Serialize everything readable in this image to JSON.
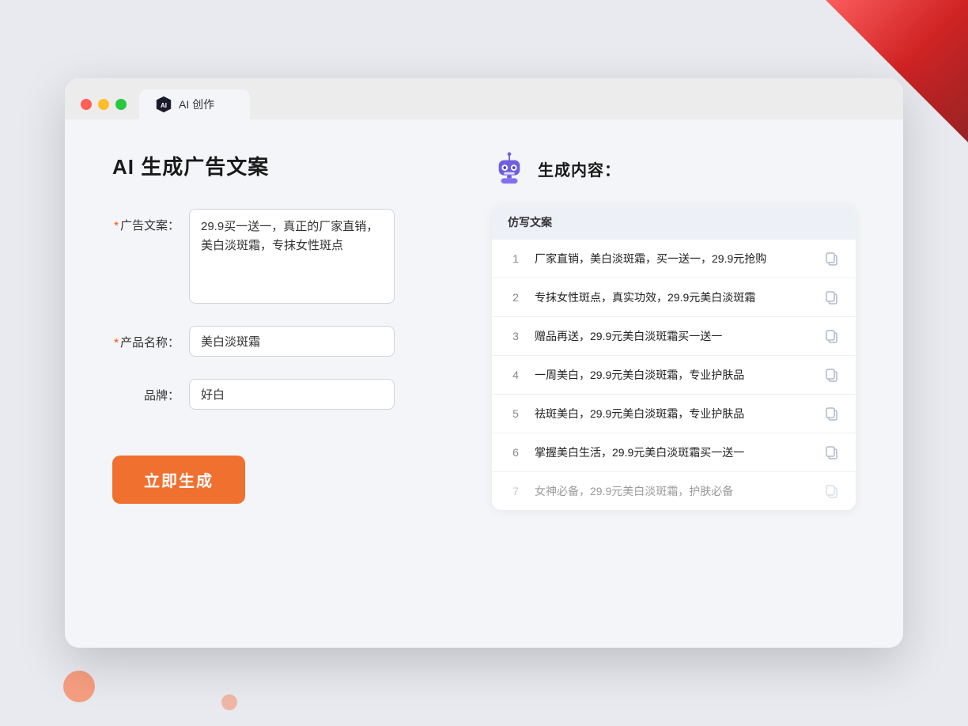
{
  "window": {
    "tab_label": "AI 创作"
  },
  "page": {
    "title": "AI 生成广告文案",
    "result_title": "生成内容："
  },
  "form": {
    "ad_copy_label": "广告文案：",
    "ad_copy_required": true,
    "ad_copy_value": "29.9买一送一，真正的厂家直销，美白淡斑霜，专抹女性斑点",
    "product_name_label": "产品名称：",
    "product_name_required": true,
    "product_name_value": "美白淡斑霜",
    "brand_label": "品牌：",
    "brand_required": false,
    "brand_value": "好白",
    "generate_btn": "立即生成"
  },
  "result": {
    "table_header": "仿写文案",
    "items": [
      {
        "num": 1,
        "text": "厂家直销，美白淡斑霜，买一送一，29.9元抢购",
        "faded": false
      },
      {
        "num": 2,
        "text": "专抹女性斑点，真实功效，29.9元美白淡斑霜",
        "faded": false
      },
      {
        "num": 3,
        "text": "赠品再送，29.9元美白淡斑霜买一送一",
        "faded": false
      },
      {
        "num": 4,
        "text": "一周美白，29.9元美白淡斑霜，专业护肤品",
        "faded": false
      },
      {
        "num": 5,
        "text": "祛斑美白，29.9元美白淡斑霜，专业护肤品",
        "faded": false
      },
      {
        "num": 6,
        "text": "掌握美白生活，29.9元美白淡斑霜买一送一",
        "faded": false
      },
      {
        "num": 7,
        "text": "女神必备，29.9元美白淡斑霜，护肤必备",
        "faded": true
      }
    ]
  },
  "colors": {
    "accent": "#f07030",
    "primary": "#5b6cf0",
    "required": "#ff4d00"
  }
}
